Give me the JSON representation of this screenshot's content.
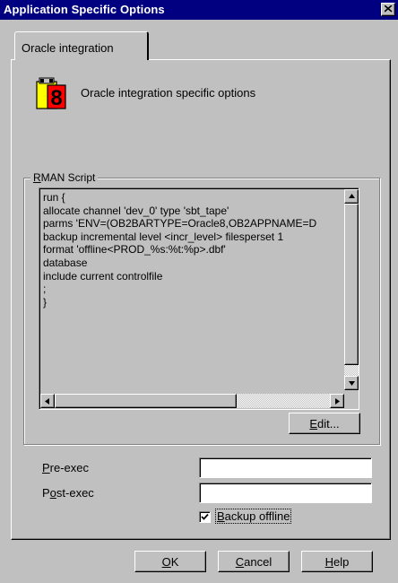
{
  "window": {
    "title": "Application Specific Options"
  },
  "tabs": [
    {
      "label": "Oracle integration",
      "active": true
    }
  ],
  "header": {
    "icon": "oracle8-icon",
    "text": "Oracle integration specific options"
  },
  "rman": {
    "group_mnemonic": "R",
    "group_rest": "MAN Script",
    "lines": [
      "run {",
      "allocate channel 'dev_0' type 'sbt_tape'",
      "parms 'ENV=(OB2BARTYPE=Oracle8,OB2APPNAME=D",
      "backup incremental level <incr_level> filesperset 1",
      "format 'offline<PROD_%s:%t:%p>.dbf'",
      "database",
      "include current controlfile",
      ";",
      "}"
    ],
    "edit_mnemonic": "E",
    "edit_rest": "dit..."
  },
  "fields": {
    "pre_exec_mnemonic": "P",
    "pre_exec_rest": "re-exec",
    "pre_exec_value": "",
    "post_exec_first": "P",
    "post_exec_mnemonic": "o",
    "post_exec_rest": "st-exec",
    "post_exec_value": ""
  },
  "backup_offline": {
    "mnemonic": "B",
    "rest": "ackup offline",
    "checked": true
  },
  "buttons": {
    "ok_mnemonic": "O",
    "ok_rest": "K",
    "cancel_mnemonic": "C",
    "cancel_rest": "ancel",
    "help_mnemonic": "H",
    "help_rest": "elp"
  },
  "colors": {
    "titlebar": "#000080",
    "face": "#c0c0c0",
    "icon_yellow": "#ffff00",
    "icon_red": "#ff0000"
  }
}
